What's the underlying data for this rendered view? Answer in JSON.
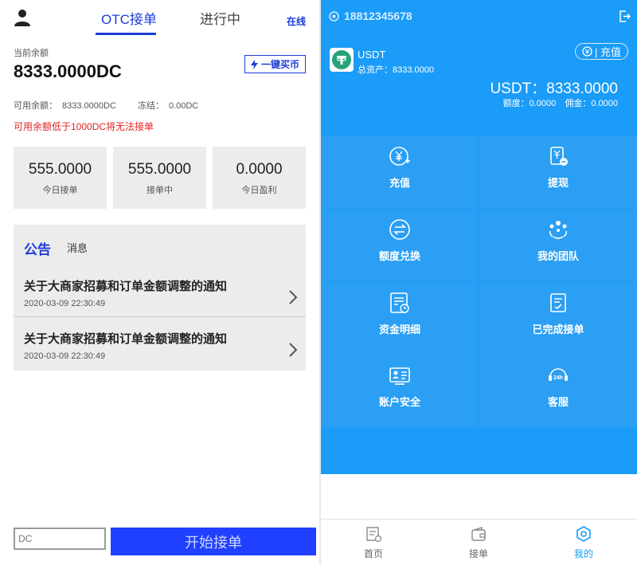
{
  "otc": {
    "tabs": {
      "otc": "OTC接单",
      "progress": "进行中"
    },
    "online": "在线",
    "balance_caption": "当前余额",
    "balance_value": "8333.0000DC",
    "buy_button": "一键买币",
    "available_label": "可用余额：",
    "available_value": "8333.0000DC",
    "frozen_label": "冻结：",
    "frozen_value": "0.00DC",
    "warning": "可用余额低于1000DC将无法接单",
    "stats": [
      {
        "value": "555.0000",
        "label": "今日接单"
      },
      {
        "value": "555.0000",
        "label": "接单中"
      },
      {
        "value": "0.0000",
        "label": "今日盈利"
      }
    ],
    "notice_tabs": {
      "announcement": "公告",
      "message": "消息"
    },
    "notices": [
      {
        "title": "关于大商家招募和订单金额调整的通知",
        "date": "2020-03-09 22:30:49"
      },
      {
        "title": "关于大商家招募和订单金额调整的通知",
        "date": "2020-03-09 22:30:49"
      }
    ],
    "dc_input_placeholder": "DC",
    "start_button": "开始接单"
  },
  "mine": {
    "phone": "18812345678",
    "coin_name": "USDT",
    "total_assets_label": "总资产：",
    "total_assets_value": "8333.0000",
    "recharge_pill": "| 充值",
    "usdt_line": "USDT：8333.0000",
    "quota_label": "额度：",
    "quota_value": "0.0000",
    "commission_label": "佣金：",
    "commission_value": "0.0000",
    "menu": [
      {
        "label": "充值",
        "icon": "recharge-icon"
      },
      {
        "label": "提现",
        "icon": "withdraw-icon"
      },
      {
        "label": "额度兑换",
        "icon": "exchange-icon"
      },
      {
        "label": "我的团队",
        "icon": "team-icon"
      },
      {
        "label": "资金明细",
        "icon": "funds-detail-icon"
      },
      {
        "label": "已完成接单",
        "icon": "completed-orders-icon"
      },
      {
        "label": "账户安全",
        "icon": "account-security-icon"
      },
      {
        "label": "客服",
        "icon": "customer-service-icon"
      }
    ],
    "bottom_nav": [
      {
        "label": "首页",
        "icon": "home-icon"
      },
      {
        "label": "接单",
        "icon": "wallet-icon"
      },
      {
        "label": "我的",
        "icon": "profile-icon"
      }
    ],
    "colors": {
      "primary": "#1a9cf8",
      "accent": "#2040ff",
      "warning": "#e52222"
    }
  }
}
